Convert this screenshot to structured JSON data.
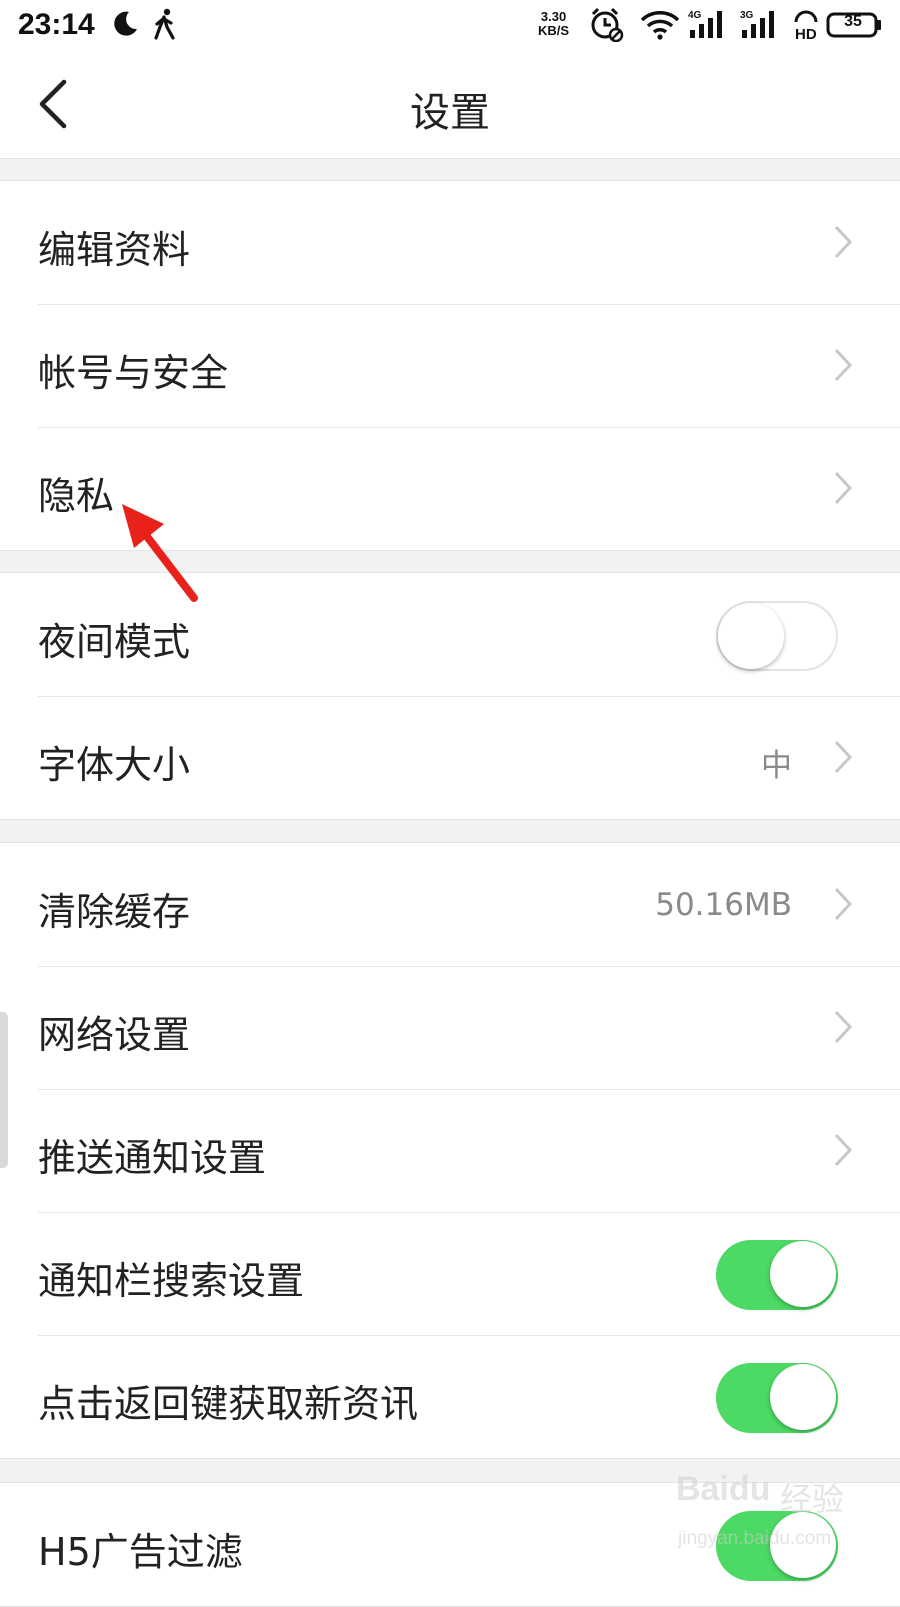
{
  "status_bar": {
    "time": "23:14",
    "speed_value": "3.30",
    "speed_unit": "KB/S",
    "net_4g": "4G",
    "net_3g": "3G",
    "hd": "HD",
    "battery": "35"
  },
  "header": {
    "title": "设置"
  },
  "groups": [
    {
      "rows": [
        {
          "label": "编辑资料"
        },
        {
          "label": "帐号与安全"
        },
        {
          "label": "隐私"
        }
      ]
    },
    {
      "rows": [
        {
          "label": "夜间模式",
          "toggle": false
        },
        {
          "label": "字体大小",
          "value": "中"
        }
      ]
    },
    {
      "rows": [
        {
          "label": "清除缓存",
          "value": "50.16MB"
        },
        {
          "label": "网络设置"
        },
        {
          "label": "推送通知设置"
        },
        {
          "label": "通知栏搜索设置",
          "toggle": true
        },
        {
          "label": "点击返回键获取新资讯",
          "toggle": true
        }
      ]
    },
    {
      "rows": [
        {
          "label": "H5广告过滤",
          "toggle": true
        }
      ]
    }
  ],
  "watermark": {
    "logo": "Baidu",
    "text": "经验",
    "url": "jingyan.baidu.com"
  },
  "colors": {
    "toggle_on": "#4cd964",
    "arrow": "#e8211b",
    "chevron": "#c7c7c7"
  }
}
